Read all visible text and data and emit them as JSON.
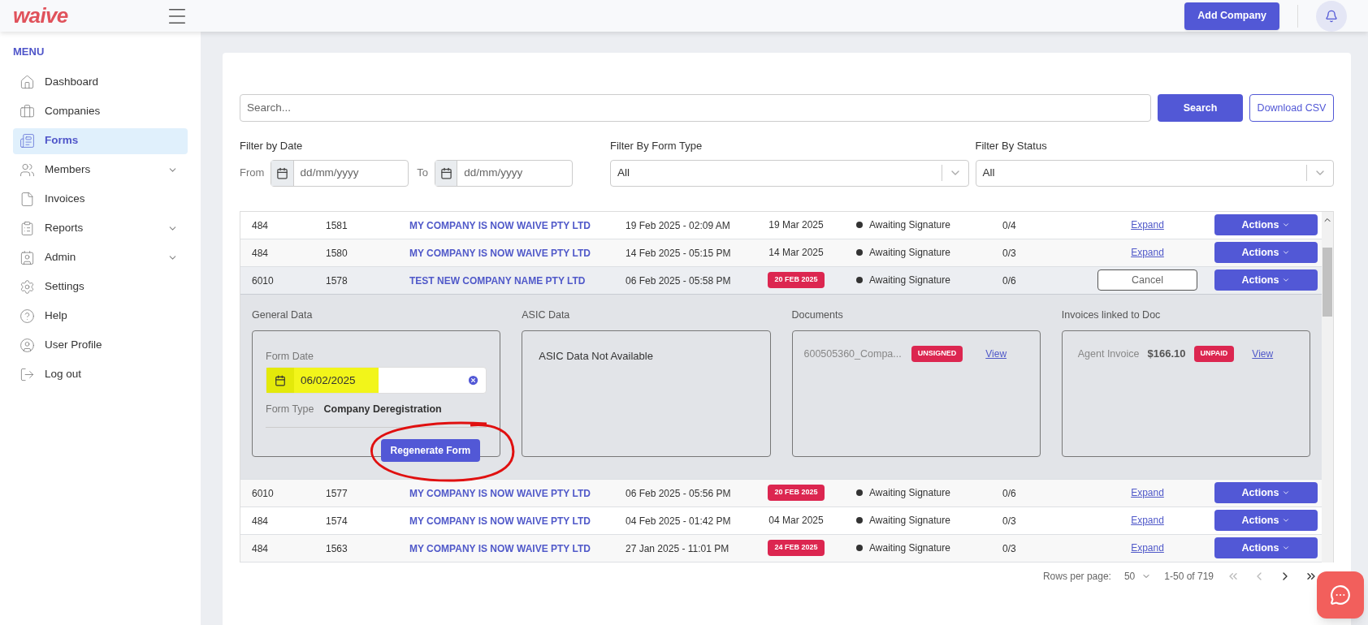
{
  "brand": "waive",
  "header": {
    "add_button": "Add Company"
  },
  "sidebar": {
    "heading": "MENU",
    "items": [
      {
        "label": "Dashboard",
        "expandable": false,
        "selected": false
      },
      {
        "label": "Companies",
        "expandable": false,
        "selected": false
      },
      {
        "label": "Forms",
        "expandable": false,
        "selected": true
      },
      {
        "label": "Members",
        "expandable": true,
        "selected": false
      },
      {
        "label": "Invoices",
        "expandable": false,
        "selected": false
      },
      {
        "label": "Reports",
        "expandable": true,
        "selected": false
      },
      {
        "label": "Admin",
        "expandable": true,
        "selected": false
      },
      {
        "label": "Settings",
        "expandable": false,
        "selected": false
      },
      {
        "label": "Help",
        "expandable": false,
        "selected": false
      },
      {
        "label": "User Profile",
        "expandable": false,
        "selected": false
      },
      {
        "label": "Log out",
        "expandable": false,
        "selected": false
      }
    ]
  },
  "search": {
    "placeholder": "Search...",
    "button": "Search",
    "csv_button": "Download CSV"
  },
  "filters": {
    "date": {
      "label": "Filter by Date",
      "from": "From",
      "to": "To",
      "from_placeholder": "dd/mm/yyyy",
      "to_placeholder": "dd/mm/yyyy"
    },
    "form_type": {
      "label": "Filter By Form Type",
      "value": "All"
    },
    "status": {
      "label": "Filter By Status",
      "value": "All"
    }
  },
  "table": {
    "rows": [
      {
        "c1": "484",
        "c2": "1581",
        "company": "MY COMPANY IS NOW WAIVE PTY LTD",
        "created": "19 Feb 2025 - 02:09 AM",
        "due": {
          "text": "19 Mar 2025",
          "overdue": false
        },
        "status": "Awaiting Signature",
        "count": "0/4",
        "link": {
          "kind": "expand",
          "label": "Expand"
        },
        "actions": "Actions",
        "expanded": false
      },
      {
        "c1": "484",
        "c2": "1580",
        "company": "MY COMPANY IS NOW WAIVE PTY LTD",
        "created": "14 Feb 2025 - 05:15 PM",
        "due": {
          "text": "14 Mar 2025",
          "overdue": false
        },
        "status": "Awaiting Signature",
        "count": "0/3",
        "link": {
          "kind": "expand",
          "label": "Expand"
        },
        "actions": "Actions",
        "expanded": false
      },
      {
        "c1": "6010",
        "c2": "1578",
        "company": "TEST NEW COMPANY NAME PTY LTD",
        "created": "06 Feb 2025 - 05:58 PM",
        "due": {
          "text": "20 FEB 2025",
          "overdue": true
        },
        "status": "Awaiting Signature",
        "count": "0/6",
        "link": {
          "kind": "cancel",
          "label": "Cancel"
        },
        "actions": "Actions",
        "expanded": true
      },
      {
        "c1": "6010",
        "c2": "1577",
        "company": "MY COMPANY IS NOW WAIVE PTY LTD",
        "created": "06 Feb 2025 - 05:56 PM",
        "due": {
          "text": "20 FEB 2025",
          "overdue": true
        },
        "status": "Awaiting Signature",
        "count": "0/6",
        "link": {
          "kind": "expand",
          "label": "Expand"
        },
        "actions": "Actions",
        "expanded": false
      },
      {
        "c1": "484",
        "c2": "1574",
        "company": "MY COMPANY IS NOW WAIVE PTY LTD",
        "created": "04 Feb 2025 - 01:42 PM",
        "due": {
          "text": "04 Mar 2025",
          "overdue": false
        },
        "status": "Awaiting Signature",
        "count": "0/3",
        "link": {
          "kind": "expand",
          "label": "Expand"
        },
        "actions": "Actions",
        "expanded": false
      },
      {
        "c1": "484",
        "c2": "1563",
        "company": "MY COMPANY IS NOW WAIVE PTY LTD",
        "created": "27 Jan 2025 - 11:01 PM",
        "due": {
          "text": "24 FEB 2025",
          "overdue": true
        },
        "status": "Awaiting Signature",
        "count": "0/3",
        "link": {
          "kind": "expand",
          "label": "Expand"
        },
        "actions": "Actions",
        "expanded": false
      }
    ]
  },
  "details": {
    "general": {
      "title": "General Data",
      "date_label": "Form Date",
      "date_value": "06/02/2025",
      "highlighted": true,
      "type_label": "Form Type",
      "type_value": "Company Deregistration",
      "button": "Regenerate Form",
      "circled": true
    },
    "asic": {
      "title": "ASIC Data",
      "text": "ASIC Data Not Available"
    },
    "documents": {
      "title": "Documents",
      "items": [
        {
          "name": "600505360_Compa...",
          "badge": "UNSIGNED",
          "link": "View"
        }
      ]
    },
    "invoices": {
      "title": "Invoices linked to Doc",
      "items": [
        {
          "label": "Agent Invoice",
          "amount": "$166.10",
          "badge": "UNPAID",
          "link": "View"
        }
      ]
    }
  },
  "pagination": {
    "rows_label": "Rows per page:",
    "rows_value": "50",
    "range": "1-50 of 719"
  }
}
